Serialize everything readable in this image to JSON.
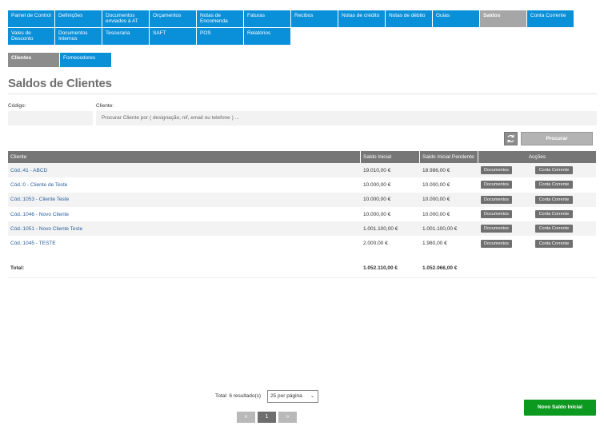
{
  "nav": {
    "items": [
      {
        "label": "Painel de Control",
        "active": false
      },
      {
        "label": "Definições",
        "active": false
      },
      {
        "label": "Documentos enviados à AT",
        "active": false
      },
      {
        "label": "Orçamentos",
        "active": false
      },
      {
        "label": "Notas de Encomenda",
        "active": false
      },
      {
        "label": "Faturas",
        "active": false
      },
      {
        "label": "Recibos",
        "active": false
      },
      {
        "label": "Notas de crédito",
        "active": false
      },
      {
        "label": "Notas de débito",
        "active": false
      },
      {
        "label": "Guias",
        "active": false
      },
      {
        "label": "Saldos",
        "active": true
      },
      {
        "label": "Conta Corrente",
        "active": false
      },
      {
        "label": "Vales de Desconto",
        "active": false
      },
      {
        "label": "Documentos Internos",
        "active": false
      },
      {
        "label": "Tesouraria",
        "active": false
      },
      {
        "label": "SAFT",
        "active": false
      },
      {
        "label": "POS",
        "active": false
      },
      {
        "label": "Relatórios",
        "active": false
      }
    ]
  },
  "subnav": {
    "clientes": "Clientes",
    "fornecedores": "Fornecedores"
  },
  "page": {
    "title": "Saldos de Clientes"
  },
  "filters": {
    "codigo_label": "Código:",
    "codigo_value": "",
    "cliente_label": "Cliente:",
    "cliente_placeholder": "Procurar Cliente por ( designação, nif, email ou telefone ) ...",
    "search_label": "Procurar"
  },
  "table": {
    "headers": {
      "cliente": "Cliente",
      "saldo_inicial": "Saldo Inicial",
      "saldo_pendente": "Saldo Inicial Pendente",
      "accoes": "Acções"
    },
    "rows": [
      {
        "cliente": "Cód.:41 - ABCD",
        "saldo_inicial": "19.010,00 €",
        "saldo_pendente": "18.986,00 €"
      },
      {
        "cliente": "Cód.:0 - Cliente de Teste",
        "saldo_inicial": "10.000,00 €",
        "saldo_pendente": "10.000,00 €"
      },
      {
        "cliente": "Cód.:1053 - Cliente Teste",
        "saldo_inicial": "10.000,00 €",
        "saldo_pendente": "10.000,00 €"
      },
      {
        "cliente": "Cód.:1046 - Novo Cliente",
        "saldo_inicial": "10.000,00 €",
        "saldo_pendente": "10.000,00 €"
      },
      {
        "cliente": "Cód.:1051 - Novo Cliente Teste",
        "saldo_inicial": "1.001.100,00 €",
        "saldo_pendente": "1.001.100,00 €"
      },
      {
        "cliente": "Cód.:1045 - TESTE",
        "saldo_inicial": "2.000,00 €",
        "saldo_pendente": "1.980,00 €"
      }
    ],
    "action_documentos": "Documentos",
    "action_conta_corrente": "Conta Corrente",
    "total_label": "Total:",
    "total_saldo_inicial": "1.052.110,00 €",
    "total_saldo_pendente": "1.052.066,00 €"
  },
  "pager": {
    "total_text": "Total: 6 resultado(s)",
    "per_page": "25 por página",
    "prev": "«",
    "current": "1",
    "next": "»"
  },
  "actions": {
    "new_label": "Novo Saldo Inicial"
  }
}
